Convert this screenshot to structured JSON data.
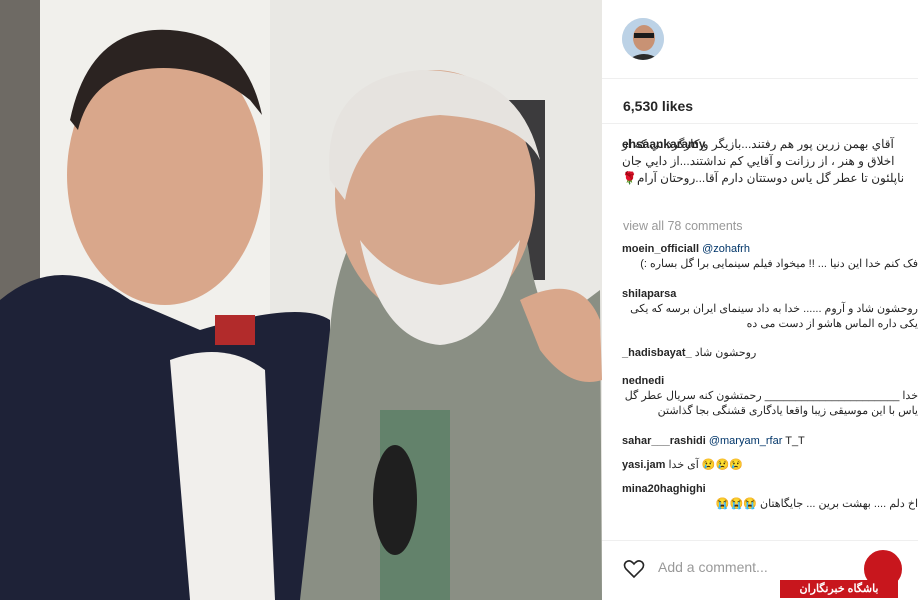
{
  "likes": "6,530 likes",
  "caption": {
    "user": "ehsaankaramy",
    "text": "آقاي بهمن زرين پور هم رفتند...بازيگر و كارگرداني كه از اخلاق و هنر ، از رزانت و آقايي كم نداشتند...از دايي جان ناپلئون تا عطر گل ياس دوستتان دارم آقا...روحتان آرام🌹"
  },
  "view_all": "view all 78 comments",
  "comments": [
    {
      "user": "moein_officiall",
      "mention": "@zohafrh",
      "text": "فک کنم خدا این دنیا ... !! میخواد فیلم سینمایی برا گل بساره :)"
    },
    {
      "user": "shilaparsa",
      "mention": "",
      "text": "روحشون شاد و آروم ...... خدا به داد سینمای ایران برسه که یکی یکی داره الماس هاشو از دست می ده"
    },
    {
      "user": "_hadisbayat_",
      "mention": "",
      "text": "روحشون شاد"
    },
    {
      "user": "nednedi",
      "mention": "",
      "text": "خدا ______________________ رحمتشون کنه سریال عطر گل یاس با این موسیقی زیبا واقعا یادگاری قشنگی بجا گذاشتن"
    },
    {
      "user": "sahar___rashidi",
      "mention": "@maryam_rfar",
      "text": "T_T"
    },
    {
      "user": "yasi.jam",
      "mention": "",
      "text": "آی خدا 😢😢😢"
    },
    {
      "user": "mina20haghighi",
      "mention": "",
      "text": "اخ دلم .... بهشت برین ... جایگاهتان 😭😭😭"
    }
  ],
  "add_comment_placeholder": "Add a comment...",
  "badge_label": "باشگاه خبرنگاران"
}
